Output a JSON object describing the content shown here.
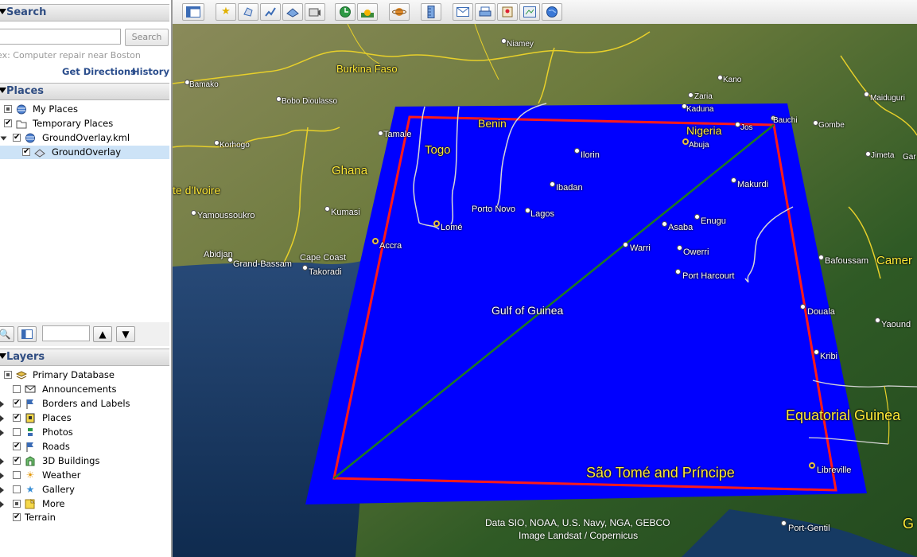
{
  "search": {
    "title": "Search",
    "placeholder": "",
    "button_label": "Search",
    "hint": "ex: Computer repair near Boston",
    "get_directions": "Get Directions",
    "history": "History"
  },
  "places": {
    "title": "Places",
    "items": [
      {
        "label": "My Places",
        "icon": "globe-icon",
        "checked": "partial"
      },
      {
        "label": "Temporary Places",
        "icon": "folder-icon",
        "checked": "checked"
      },
      {
        "label": "GroundOverlay.kml",
        "icon": "globe-icon",
        "checked": "checked"
      },
      {
        "label": "GroundOverlay",
        "icon": "overlay-icon",
        "checked": "checked",
        "selected": true
      }
    ]
  },
  "layers": {
    "title": "Layers",
    "items": [
      {
        "label": "Primary Database",
        "icon": "database-icon",
        "checked": "partial"
      },
      {
        "label": "Announcements",
        "icon": "mail-icon",
        "checked": "unchecked"
      },
      {
        "label": "Borders and Labels",
        "icon": "flag-icon",
        "checked": "checked"
      },
      {
        "label": "Places",
        "icon": "place-icon",
        "checked": "checked"
      },
      {
        "label": "Photos",
        "icon": "photo-icon",
        "checked": "unchecked"
      },
      {
        "label": "Roads",
        "icon": "road-icon",
        "checked": "checked"
      },
      {
        "label": "3D Buildings",
        "icon": "building-icon",
        "checked": "checked"
      },
      {
        "label": "Weather",
        "icon": "sun-icon",
        "checked": "unchecked"
      },
      {
        "label": "Gallery",
        "icon": "star-icon",
        "checked": "unchecked"
      },
      {
        "label": "More",
        "icon": "more-icon",
        "checked": "partial"
      },
      {
        "label": "Terrain",
        "icon": "",
        "checked": "checked"
      }
    ]
  },
  "map": {
    "attribution_line1": "Data SIO, NOAA, U.S. Navy, NGA, GEBCO",
    "attribution_line2": "Image Landsat / Copernicus",
    "overlay_color": "#0000ff",
    "border_color": "#ff0000",
    "line_color": "#1e7a1e",
    "labels": {
      "niamey": "Niamey",
      "burkina": "Burkina Faso",
      "bamako": "Bamako",
      "bobo": "Bobo Dioulasso",
      "korhogo": "Korhogo",
      "tamale": "Tamale",
      "benin": "Benin",
      "togo": "Togo",
      "ghana": "Ghana",
      "ivoire": "te d'Ivoire",
      "yamoussoukro": "Yamoussoukro",
      "kumasi": "Kumasi",
      "lome": "Lomé",
      "accra": "Accra",
      "abidjan": "Abidjan",
      "grandbassam": "Grand-Bassam",
      "capecoast": "Cape Coast",
      "takoradi": "Takoradi",
      "kano": "Kano",
      "zaria": "Zaria",
      "kaduna": "Kaduna",
      "maiduguri": "Maiduguri",
      "bauchi": "Bauchi",
      "gombe": "Gombe",
      "nigeria": "Nigeria",
      "jos": "Jos",
      "abuja": "Abuja",
      "jimeta": "Jimeta",
      "gar": "Gar",
      "ilorin": "Ilorin",
      "ibadan": "Ibadan",
      "makurdi": "Makurdi",
      "portonovo": "Porto Novo",
      "lagos": "Lagos",
      "enugu": "Enugu",
      "asaba": "Asaba",
      "warri": "Warri",
      "owerri": "Owerri",
      "portharcourt": "Port Harcourt",
      "bafoussam": "Bafoussam",
      "camer": "Camer",
      "gulf": "Gulf of Guinea",
      "douala": "Douala",
      "yaounde": "Yaound",
      "kribi": "Kribi",
      "eqguinea": "Equatorial Guinea",
      "saotome": "São Tomé and Príncipe",
      "libreville": "Libreville",
      "portgentil": "Port-Gentil",
      "g": "G"
    }
  }
}
